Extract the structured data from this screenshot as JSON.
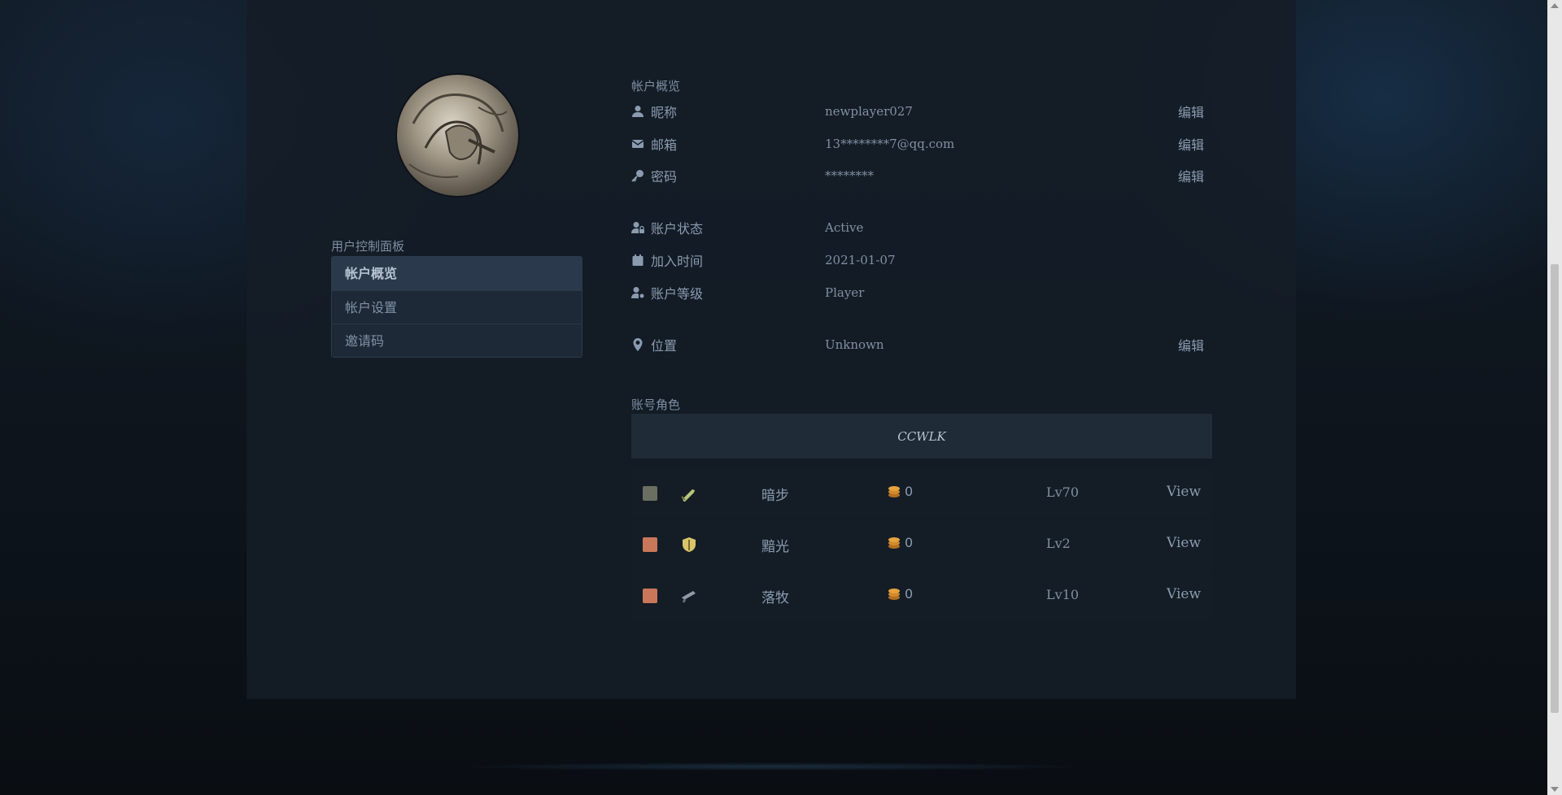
{
  "sidebar": {
    "title": "用户控制面板",
    "items": [
      {
        "label": "帐户概览",
        "active": true
      },
      {
        "label": "帐户设置",
        "active": false
      },
      {
        "label": "邀请码",
        "active": false
      }
    ]
  },
  "overview": {
    "title": "帐户概览",
    "nickname": {
      "label": "昵称",
      "value": "newplayer027",
      "edit": "编辑",
      "icon": "user-icon"
    },
    "email": {
      "label": "邮箱",
      "value": "13********7@qq.com",
      "edit": "编辑",
      "icon": "envelope-icon"
    },
    "password": {
      "label": "密码",
      "value": "********",
      "edit": "编辑",
      "icon": "key-icon"
    },
    "status": {
      "label": "账户状态",
      "value": "Active",
      "icon": "user-lock-icon"
    },
    "joined": {
      "label": "加入时间",
      "value": "2021-01-07",
      "icon": "calendar-icon"
    },
    "level": {
      "label": "账户等级",
      "value": "Player",
      "icon": "user-cog-icon"
    },
    "location": {
      "label": "位置",
      "value": "Unknown",
      "edit": "编辑",
      "icon": "map-pin-icon"
    }
  },
  "characters": {
    "title": "账号角色",
    "realm": "CCWLK",
    "list": [
      {
        "name": "暗步",
        "gold": "0",
        "level": "Lv70",
        "view": "View",
        "race_color": "#6b6f62",
        "class_icon": "sword-icon"
      },
      {
        "name": "黯光",
        "gold": "0",
        "level": "Lv2",
        "view": "View",
        "race_color": "#c9775a",
        "class_icon": "shield-icon"
      },
      {
        "name": "落牧",
        "gold": "0",
        "level": "Lv10",
        "view": "View",
        "race_color": "#c9775a",
        "class_icon": "gun-icon"
      }
    ]
  },
  "colors": {
    "accent": "#2a3a4c",
    "panel": "#141d27",
    "gold": "#c98a2e"
  }
}
